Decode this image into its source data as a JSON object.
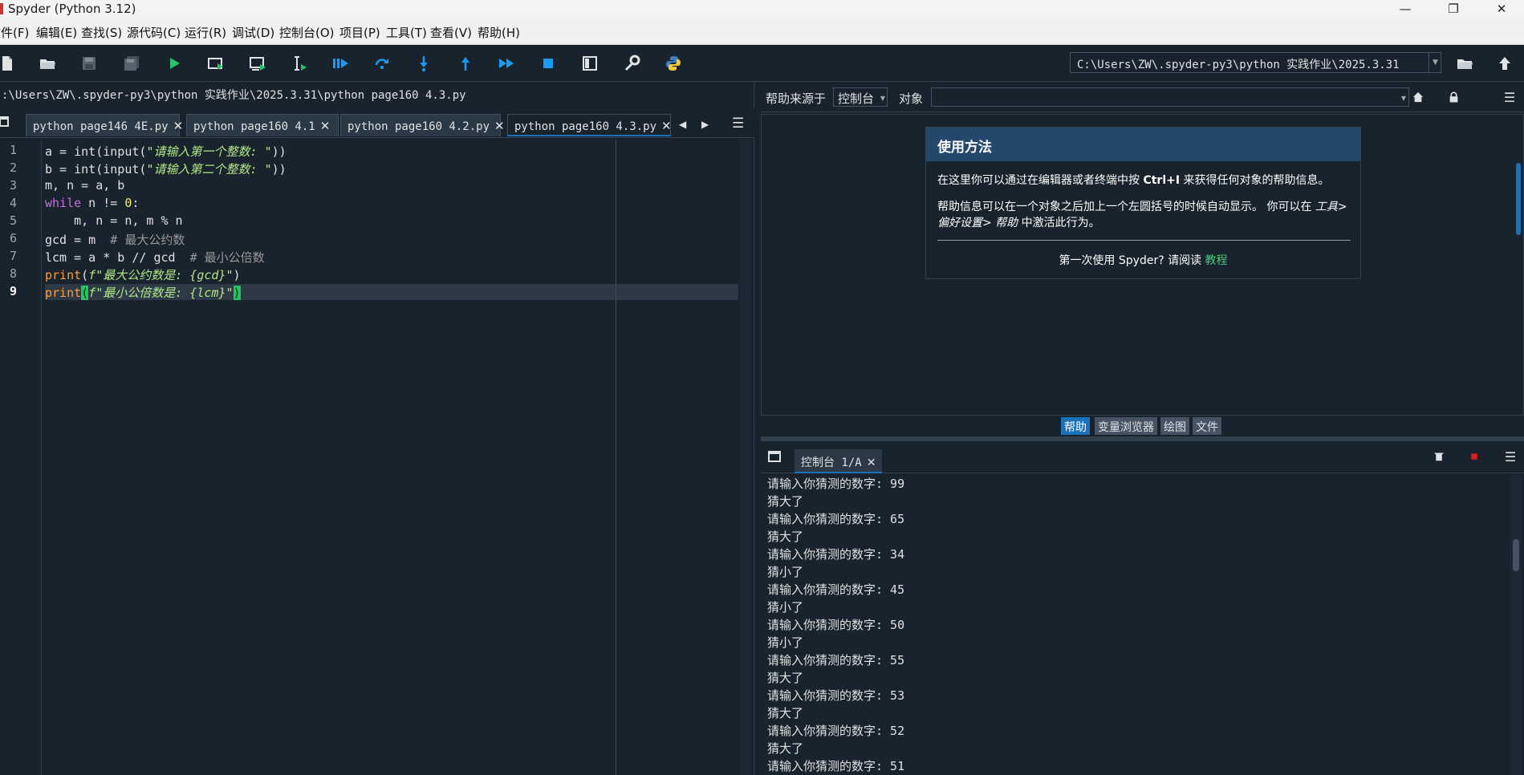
{
  "window": {
    "title": "Spyder (Python 3.12)",
    "min_glyph": "—",
    "max_glyph": "❐",
    "close_glyph": "✕"
  },
  "menu": {
    "items": [
      "文件(F)",
      "编辑(E)",
      "查找(S)",
      "源代码(C)",
      "运行(R)",
      "调试(D)",
      "控制台(O)",
      "项目(P)",
      "工具(T)",
      "查看(V)",
      "帮助(H)"
    ]
  },
  "toolbar": {
    "working_directory": "C:\\Users\\ZW\\.spyder-py3\\python 实践作业\\2025.3.31",
    "icons": [
      "new-file-icon",
      "open-file-icon",
      "save-file-icon",
      "save-all-icon",
      "run-icon",
      "run-cell-icon",
      "run-cell-advance-icon",
      "run-selection-icon",
      "debug-icon",
      "step-over-icon",
      "step-into-icon",
      "step-out-icon",
      "continue-icon",
      "stop-icon",
      "maximize-pane-icon",
      "preferences-icon",
      "python-path-icon"
    ]
  },
  "editor": {
    "file_path": ":\\Users\\ZW\\.spyder-py3\\python 实践作业\\2025.3.31\\python page160 4.3.py",
    "tabs": [
      {
        "label": "python page146 4E.py",
        "active": false
      },
      {
        "label": "python  page160 4.1",
        "active": false
      },
      {
        "label": "python page160 4.2.py",
        "active": false
      },
      {
        "label": "python page160 4.3.py",
        "active": true
      }
    ],
    "close_glyph": "✕",
    "current_line": 9,
    "line_numbers": [
      "1",
      "2",
      "3",
      "4",
      "5",
      "6",
      "7",
      "8",
      "9"
    ],
    "code": {
      "l1_a": "a = ",
      "l1_b": "int",
      "l1_c": "(",
      "l1_d": "input",
      "l1_e": "(",
      "l1_f": "\"请输入第一个整数: \"",
      "l1_g": "))",
      "l2_a": "b = ",
      "l2_b": "int",
      "l2_c": "(",
      "l2_d": "input",
      "l2_e": "(",
      "l2_f": "\"请输入第二个整数: \"",
      "l2_g": "))",
      "l3": "m, n = a, b",
      "l4_kw": "while",
      "l4_rest": " n != ",
      "l4_num": "0",
      "l4_end": ":",
      "l5": "    m, n = n, m % n",
      "l6_code": "gcd = m  ",
      "l6_cmt": "# 最大公约数",
      "l7_code": "lcm = a * b // gcd  ",
      "l7_cmt": "# 最小公倍数",
      "l8_fn": "print",
      "l8_p": "(",
      "l8_str": "f\"最大公约数是: {gcd}\"",
      "l8_end": ")",
      "l9_fn": "print",
      "l9_p": "(",
      "l9_str": "f\"最小公倍数是: {lcm}\"",
      "l9_end": ")"
    }
  },
  "help": {
    "source_label": "帮助来源于",
    "source_value": "控制台",
    "object_label": "对象",
    "object_value": "",
    "card_title": "使用方法",
    "para1_a": "在这里你可以通过在编辑器或者终端中按 ",
    "para1_key": "Ctrl+I",
    "para1_b": " 来获得任何对象的帮助信息。",
    "para2_a": "帮助信息可以在一个对象之后加上一个左圆括号的时候自动显示。 你可以在 ",
    "para2_menu": "工具> 偏好设置> 帮助",
    "para2_b": " 中激活此行为。",
    "footer_text": "第一次使用 Spyder? 请阅读 ",
    "footer_link": "教程",
    "bottom_tabs": [
      {
        "label": "帮助",
        "active": true
      },
      {
        "label": "变量浏览器",
        "active": false
      },
      {
        "label": "绘图",
        "active": false
      },
      {
        "label": "文件",
        "active": false
      }
    ]
  },
  "console": {
    "tab_label": "控制台 1/A",
    "close_glyph": "✕",
    "lines": [
      "请输入你猜测的数字: 99",
      "猜大了",
      "请输入你猜测的数字: 65",
      "猜大了",
      "请输入你猜测的数字: 34",
      "猜小了",
      "请输入你猜测的数字: 45",
      "猜小了",
      "请输入你猜测的数字: 50",
      "猜小了",
      "请输入你猜测的数字: 55",
      "猜大了",
      "请输入你猜测的数字: 53",
      "猜大了",
      "请输入你猜测的数字: 52",
      "猜大了",
      "请输入你猜测的数字: 51"
    ]
  },
  "colors": {
    "background": "#19232d",
    "accent": "#1a72bb",
    "run_green": "#29c36a",
    "stop_blue": "#1a9bf0",
    "stop_red": "#e01e1e"
  }
}
